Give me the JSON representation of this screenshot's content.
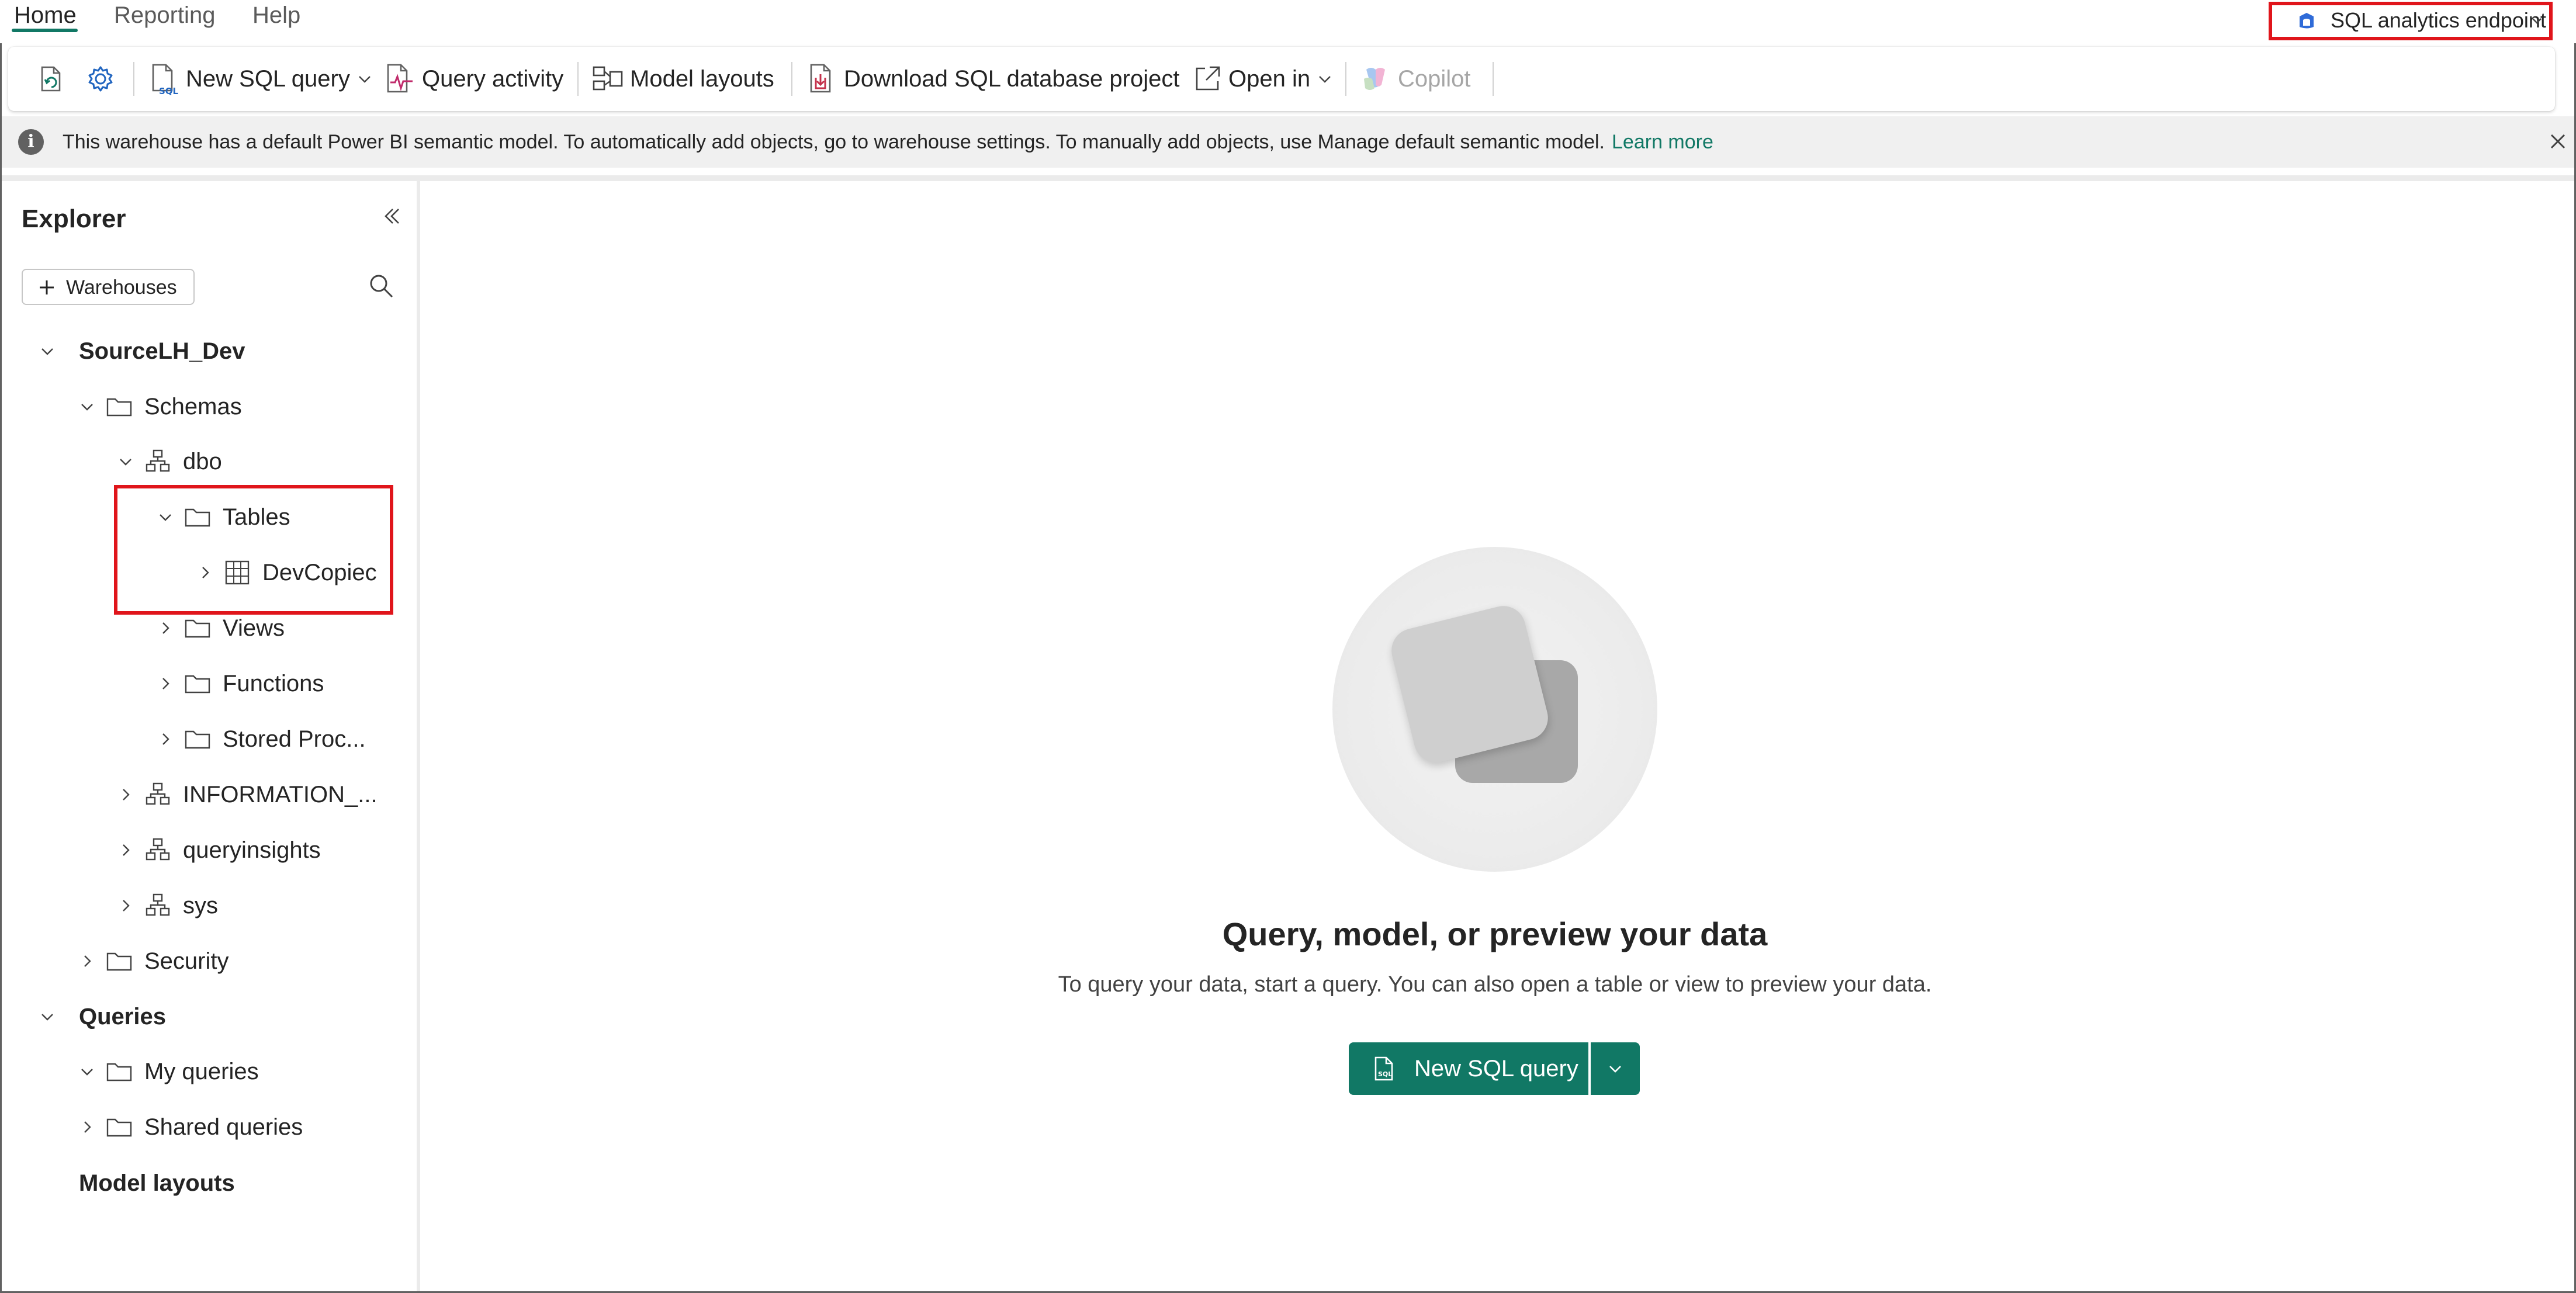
{
  "tabs": [
    {
      "label": "Home",
      "active": true
    },
    {
      "label": "Reporting",
      "active": false
    },
    {
      "label": "Help",
      "active": false
    }
  ],
  "endpoint_switcher": {
    "label": "SQL analytics endpoint",
    "icon": "sql-endpoint-icon"
  },
  "toolbar": {
    "refresh_icon": "refresh-icon",
    "settings_icon": "gear-icon",
    "new_sql_query": "New SQL query",
    "query_activity": "Query activity",
    "model_layouts": "Model layouts",
    "download_project": "Download SQL database project",
    "open_in": "Open in",
    "copilot": "Copilot"
  },
  "info_bar": {
    "message": "This warehouse has a default Power BI semantic model. To automatically add objects, go to warehouse settings. To manually add objects, use Manage default semantic model.",
    "link": "Learn more"
  },
  "explorer": {
    "title": "Explorer",
    "add_warehouses": "Warehouses",
    "tree": {
      "root": "SourceLH_Dev",
      "schemas": "Schemas",
      "dbo": "dbo",
      "tables": "Tables",
      "devcopied": "DevCopiec",
      "views": "Views",
      "functions": "Functions",
      "stored_procs": "Stored Proc...",
      "information_schema": "INFORMATION_...",
      "queryinsights": "queryinsights",
      "sys": "sys",
      "security": "Security",
      "queries": "Queries",
      "my_queries": "My queries",
      "shared_queries": "Shared queries",
      "model_layouts": "Model layouts"
    }
  },
  "empty_state": {
    "title": "Query, model, or preview your data",
    "subtitle": "To query your data, start a query. You can also open a table or view to preview your data.",
    "cta_label": "New SQL query"
  },
  "colors": {
    "accent": "#117865",
    "highlight": "#e0151b"
  }
}
